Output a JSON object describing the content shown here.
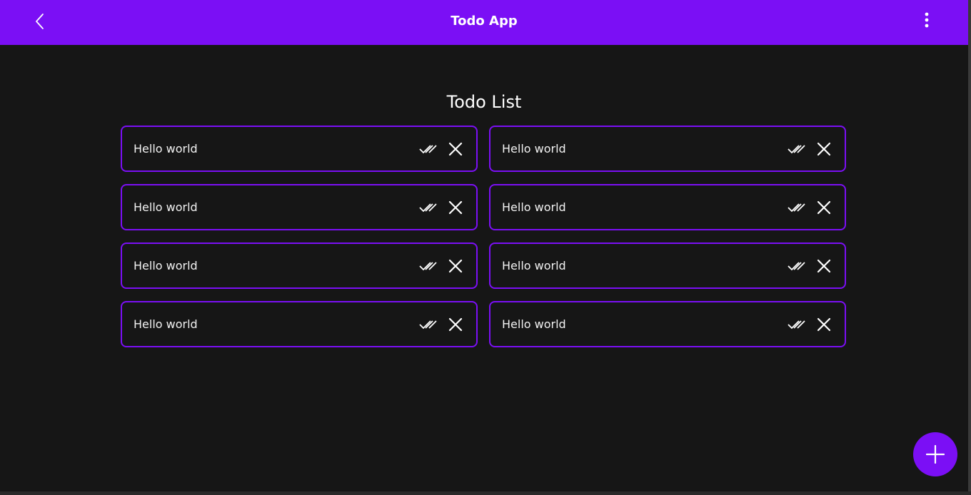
{
  "appbar": {
    "title": "Todo App",
    "back_icon": "chevron-left-icon",
    "menu_icon": "more-vertical-icon",
    "color": "#7b0ff5"
  },
  "main": {
    "heading": "Todo List",
    "todos": [
      {
        "text": "Hello world"
      },
      {
        "text": "Hello world"
      },
      {
        "text": "Hello world"
      },
      {
        "text": "Hello world"
      },
      {
        "text": "Hello world"
      },
      {
        "text": "Hello world"
      },
      {
        "text": "Hello world"
      },
      {
        "text": "Hello world"
      }
    ],
    "done_icon": "double-check-icon",
    "delete_icon": "close-icon"
  },
  "fab": {
    "icon": "plus-icon"
  },
  "colors": {
    "accent": "#7b0ff5",
    "background": "#161616",
    "text": "#f2f2f2"
  }
}
